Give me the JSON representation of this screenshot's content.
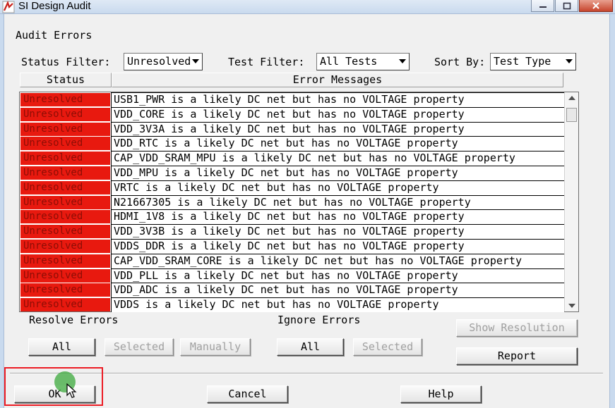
{
  "window": {
    "title": "SI Design Audit",
    "icon": "app-logo-icon",
    "controls": [
      "minimize-icon",
      "maximize-icon",
      "close-icon"
    ]
  },
  "section_title": "Audit Errors",
  "filters": {
    "status_label": "Status Filter:",
    "status_value": "Unresolved",
    "test_label": "Test Filter:",
    "test_value": "All Tests",
    "sort_label": "Sort By:",
    "sort_value": "Test Type"
  },
  "table": {
    "columns": [
      "Status",
      "Error Messages"
    ],
    "rows": [
      {
        "status": "Unresolved",
        "message": "USB1_PWR is a likely DC net but has no VOLTAGE property"
      },
      {
        "status": "Unresolved",
        "message": "VDD_CORE is a likely DC net but has no VOLTAGE property"
      },
      {
        "status": "Unresolved",
        "message": "VDD_3V3A is a likely DC net but has no VOLTAGE property"
      },
      {
        "status": "Unresolved",
        "message": "VDD_RTC is a likely DC net but has no VOLTAGE property"
      },
      {
        "status": "Unresolved",
        "message": "CAP_VDD_SRAM_MPU is a likely DC net but has no VOLTAGE property"
      },
      {
        "status": "Unresolved",
        "message": "VDD_MPU is a likely DC net but has no VOLTAGE property"
      },
      {
        "status": "Unresolved",
        "message": "VRTC is a likely DC net but has no VOLTAGE property"
      },
      {
        "status": "Unresolved",
        "message": "N21667305 is a likely DC net but has no VOLTAGE property"
      },
      {
        "status": "Unresolved",
        "message": "HDMI_1V8 is a likely DC net but has no VOLTAGE property"
      },
      {
        "status": "Unresolved",
        "message": "VDD_3V3B is a likely DC net but has no VOLTAGE property"
      },
      {
        "status": "Unresolved",
        "message": "VDDS_DDR is a likely DC net but has no VOLTAGE property"
      },
      {
        "status": "Unresolved",
        "message": "CAP_VDD_SRAM_CORE is a likely DC net but has no VOLTAGE property"
      },
      {
        "status": "Unresolved",
        "message": "VDD_PLL is a likely DC net but has no VOLTAGE property"
      },
      {
        "status": "Unresolved",
        "message": "VDD_ADC is a likely DC net but has no VOLTAGE property"
      },
      {
        "status": "Unresolved",
        "message": "VDDS is a likely DC net but has no VOLTAGE property"
      }
    ],
    "status_color": "#e8190f"
  },
  "resolve": {
    "label": "Resolve Errors",
    "all": "All",
    "selected": "Selected",
    "manually": "Manually"
  },
  "ignore": {
    "label": "Ignore Errors",
    "all": "All",
    "selected": "Selected"
  },
  "buttons": {
    "show_resolution": "Show Resolution",
    "report": "Report",
    "ok": "OK",
    "cancel": "Cancel",
    "help": "Help"
  },
  "highlight_color": "#ec1c24"
}
